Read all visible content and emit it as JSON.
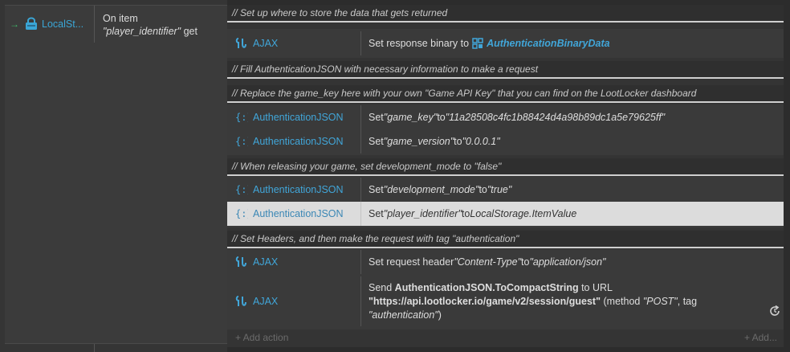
{
  "event": {
    "trigger": {
      "name": "LocalSt...",
      "arrow": "→",
      "icon": "localstorage-icon"
    },
    "condition": {
      "line1": "On item",
      "line2_key": "\"player_identifier\"",
      "line2_suffix": " get"
    }
  },
  "comments": {
    "c1": "//  Set up where to store the data that gets returned",
    "c2": "//  Fill AuthenticationJSON with necessary information to make a request",
    "c3": "//  Replace the game_key here with your own \"Game API Key\" that you can find on the LootLocker dashboard",
    "c4": "//  When releasing your game, set development_mode to \"false\"",
    "c5": "//  Set Headers, and then make the request with tag \"authentication\""
  },
  "actions": {
    "a1": {
      "object": "AJAX",
      "text": "Set response binary to ",
      "value": "AuthenticationBinaryData"
    },
    "a2": {
      "object": "AuthenticationJSON",
      "pre": "Set ",
      "key": "\"game_key\"",
      "mid": " to ",
      "val": "\"11a28508c4fc1b88424d4a98b89dc1a5e79625ff\""
    },
    "a3": {
      "object": "AuthenticationJSON",
      "pre": "Set ",
      "key": "\"game_version\"",
      "mid": " to ",
      "val": "\"0.0.0.1\""
    },
    "a4": {
      "object": "AuthenticationJSON",
      "pre": "Set ",
      "key": "\"development_mode\"",
      "mid": " to ",
      "val": "\"true\""
    },
    "a5": {
      "object": "AuthenticationJSON",
      "pre": "Set ",
      "key": "\"player_identifier\"",
      "mid": " to ",
      "val": "LocalStorage.ItemValue"
    },
    "a6": {
      "object": "AJAX",
      "pre": "Set request header ",
      "key": "\"Content-Type\"",
      "mid": " to ",
      "val": "\"application/json\""
    },
    "a7": {
      "object": "AJAX",
      "send": "Send ",
      "expr": "AuthenticationJSON.ToCompactString",
      "to_url": " to URL",
      "url": "\"https://api.lootlocker.io/game/v2/session/guest\"",
      "method_pre": " (method ",
      "method": "\"POST\"",
      "tag_pre": ", tag",
      "tag": "\"authentication\"",
      "close": ")"
    }
  },
  "footer": {
    "add_action": "+ Add action",
    "add_more": "+ Add..."
  },
  "colors": {
    "accent": "#41a6d9",
    "trigger_arrow": "#3fb96a",
    "selected_row": "#dcdcdc"
  },
  "icons": {
    "ajax": "ajax-icon",
    "json": "json-braces-icon",
    "binary": "binary-data-icon",
    "refresh": "refresh-icon"
  }
}
